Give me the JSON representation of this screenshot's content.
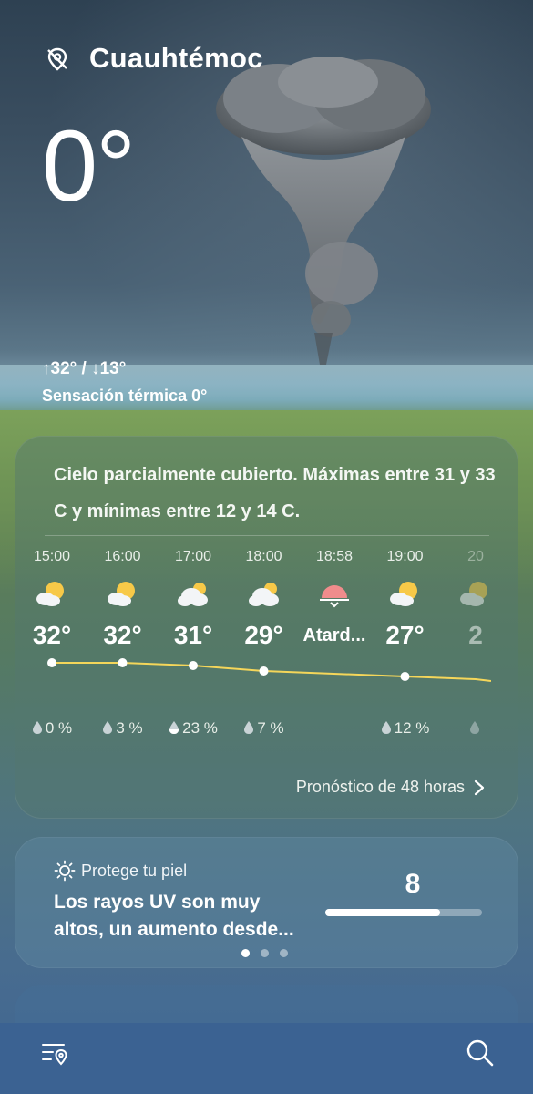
{
  "header": {
    "location_icon": "location-off-icon",
    "city": "Cuauhtémoc",
    "current_temp": "0°",
    "hi_lo": "↑32° / ↓13°",
    "feels_like": "Sensación térmica 0°"
  },
  "summary": {
    "description": "Cielo parcialmente cubierto. Máximas entre 31 y 33 C y mínimas entre 12 y 14 C."
  },
  "hourly": [
    {
      "time": "15:00",
      "icon": "partly-cloudy-icon",
      "temp": "32°",
      "precip": "0 %",
      "drop": "empty"
    },
    {
      "time": "16:00",
      "icon": "partly-cloudy-icon",
      "temp": "32°",
      "precip": "3 %",
      "drop": "empty"
    },
    {
      "time": "17:00",
      "icon": "mostly-cloudy-icon",
      "temp": "31°",
      "precip": "23 %",
      "drop": "half"
    },
    {
      "time": "18:00",
      "icon": "mostly-cloudy-icon",
      "temp": "29°",
      "precip": "7 %",
      "drop": "empty"
    },
    {
      "time": "18:58",
      "icon": "sunset-icon",
      "temp": "Atard...",
      "precip": "",
      "drop": "none"
    },
    {
      "time": "19:00",
      "icon": "partly-cloudy-icon",
      "temp": "27°",
      "precip": "12 %",
      "drop": "empty"
    },
    {
      "time": "20",
      "icon": "partly-cloudy-icon",
      "temp": "2",
      "precip": "",
      "drop": "empty"
    }
  ],
  "forecast_link": "Pronóstico de 48 horas",
  "uv": {
    "heading": "Protege tu piel",
    "text_line1": "Los rayos UV son muy",
    "text_line2": "altos, un aumento desde...",
    "value": "8",
    "level_fraction": 0.73
  },
  "pager": {
    "count": 3,
    "active": 0
  },
  "nav": {
    "left_icon": "location-list-icon",
    "right_icon": "search-icon"
  },
  "colors": {
    "curve": "#f5d65a",
    "sun": "#f7c948",
    "sunset": "#f08c8c"
  }
}
